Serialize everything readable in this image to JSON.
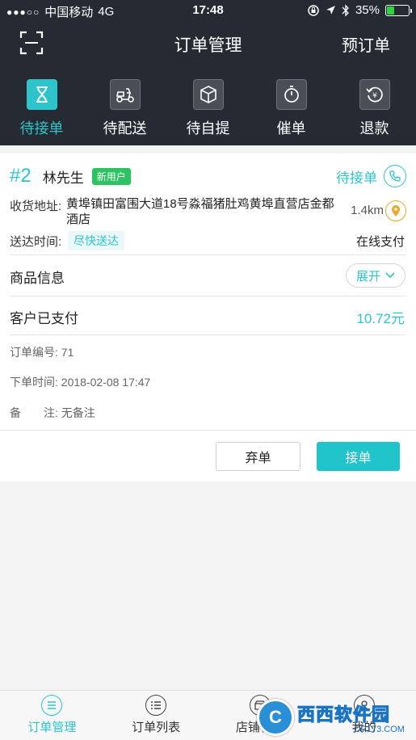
{
  "status_bar": {
    "signal_dots": "●●●○○",
    "carrier": "中国移动",
    "network": "4G",
    "time": "17:48",
    "battery": "35%",
    "battery_level": 0.35
  },
  "nav": {
    "title": "订单管理",
    "right_action": "预订单"
  },
  "tabs": [
    {
      "label": "待接单",
      "active": true
    },
    {
      "label": "待配送",
      "active": false
    },
    {
      "label": "待自提",
      "active": false
    },
    {
      "label": "催单",
      "active": false
    },
    {
      "label": "退款",
      "active": false
    }
  ],
  "order": {
    "number": "#2",
    "customer": "林先生",
    "badge": "新用户",
    "status": "待接单",
    "address_label": "收货地址:",
    "address": "黄埠镇田富围大道18号淼福猪肚鸡黄埠直营店金都酒店",
    "distance": "1.4km",
    "delivery_label": "送达时间:",
    "delivery_value": "尽快送达",
    "payment_type": "在线支付",
    "goods_label": "商品信息",
    "expand_label": "展开",
    "paid_label": "客户已支付",
    "amount": "10.72元",
    "order_id_line": "订单编号: 71",
    "order_time_line": "下单时间: 2018-02-08 17:47",
    "remark_line": "备　　注: 无备注",
    "abandon_label": "弃单",
    "accept_label": "接单"
  },
  "bottom_nav": [
    {
      "label": "订单管理",
      "active": true,
      "icon": "order-manage-icon"
    },
    {
      "label": "订单列表",
      "active": false,
      "icon": "list-icon"
    },
    {
      "label": "店铺管理",
      "active": false,
      "icon": "shop-icon"
    },
    {
      "label": "我的",
      "active": false,
      "icon": "user-icon"
    }
  ],
  "watermark": {
    "brand": "西西软件园",
    "url": "CR173.COM"
  },
  "colors": {
    "accent": "#2ec4cc",
    "header_bg": "#262b33",
    "badge_green": "#2dc262",
    "location_orange": "#e8a92b"
  }
}
